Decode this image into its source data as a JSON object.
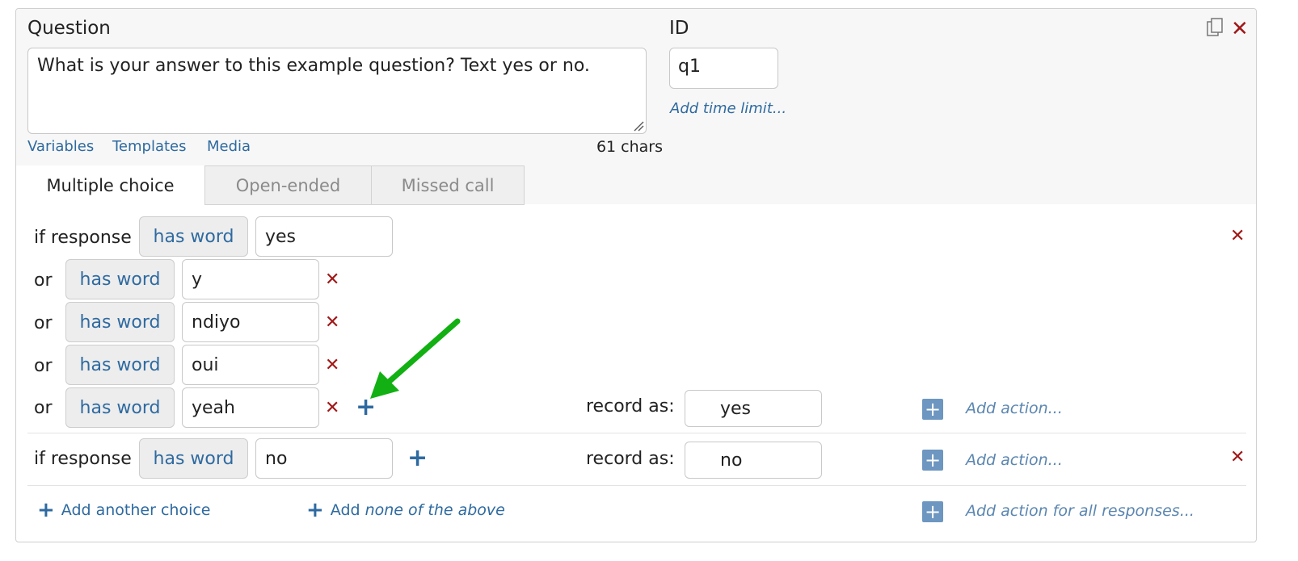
{
  "question": {
    "label": "Question",
    "text": "What is your answer to this example question? Text yes or no.",
    "links": [
      "Variables",
      "Templates",
      "Media"
    ],
    "char_count": "61 chars"
  },
  "id_field": {
    "label": "ID",
    "value": "q1",
    "time_limit_link": "Add time limit..."
  },
  "tabs": [
    "Multiple choice",
    "Open-ended",
    "Missed call"
  ],
  "choices": {
    "if_label": "if response",
    "or_label": "or",
    "condition": "has word",
    "record_label": "record as:",
    "add_action": "Add action...",
    "choice1": {
      "words": [
        "yes",
        "y",
        "ndiyo",
        "oui",
        "yeah"
      ],
      "record_as": "yes"
    },
    "choice2": {
      "words": [
        "no"
      ],
      "record_as": "no"
    }
  },
  "footer": {
    "add_choice": "Add another choice",
    "add_none_prefix": "Add",
    "add_none_italic": "none of the above",
    "add_action_all": "Add action for all responses..."
  },
  "colors": {
    "link": "#2e6aa0",
    "delete": "#a01818",
    "annotation_arrow": "#12b012"
  }
}
